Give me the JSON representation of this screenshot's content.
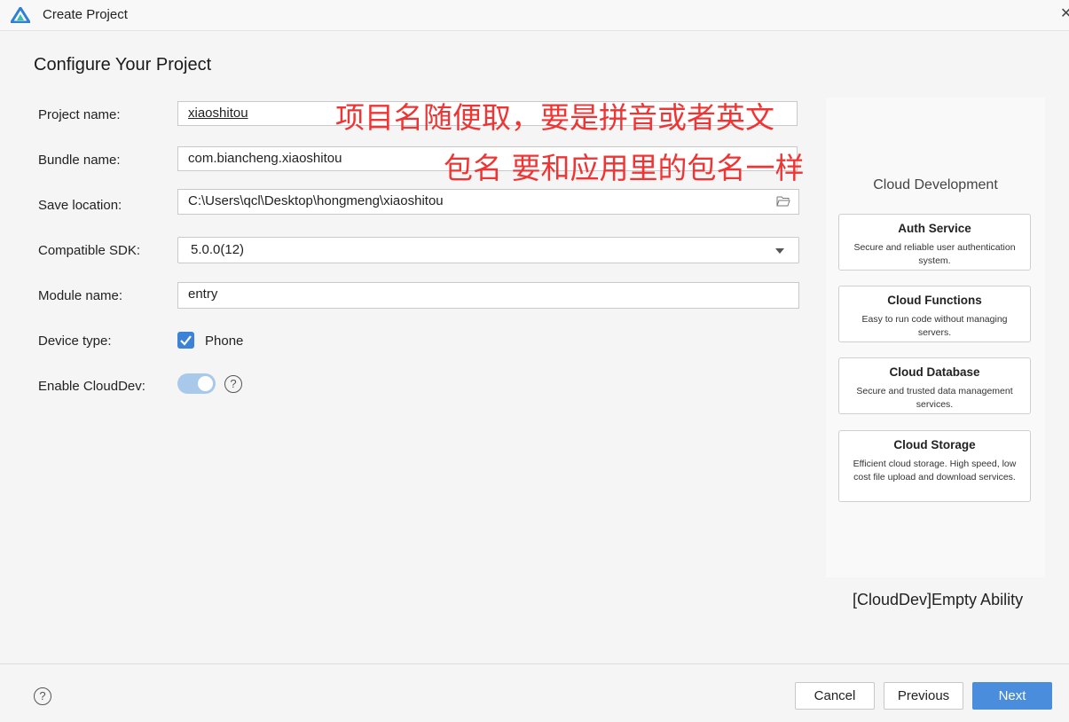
{
  "window": {
    "title": "Create Project"
  },
  "page": {
    "heading": "Configure Your Project"
  },
  "form": {
    "project_name": {
      "label": "Project name:",
      "value": "xiaoshitou"
    },
    "bundle_name": {
      "label": "Bundle name:",
      "value": "com.biancheng.xiaoshitou"
    },
    "save_location": {
      "label": "Save location:",
      "value": "C:\\Users\\qcl\\Desktop\\hongmeng\\xiaoshitou"
    },
    "compatible_sdk": {
      "label": "Compatible SDK:",
      "value": "5.0.0(12)"
    },
    "module_name": {
      "label": "Module name:",
      "value": "entry"
    },
    "device_type": {
      "label": "Device type:",
      "option": "Phone",
      "checked": true
    },
    "enable_clouddev": {
      "label": "Enable CloudDev:",
      "enabled": true
    }
  },
  "annotations": {
    "line1": "项目名随便取，要是拼音或者英文",
    "line2": "包名 要和应用里的包名一样"
  },
  "cloud_panel": {
    "heading": "Cloud Development",
    "services": [
      {
        "title": "Auth Service",
        "desc": "Secure and reliable user authentication system."
      },
      {
        "title": "Cloud Functions",
        "desc": "Easy to run code without managing servers."
      },
      {
        "title": "Cloud Database",
        "desc": "Secure and trusted data management services."
      },
      {
        "title": "Cloud Storage",
        "desc": "Efficient cloud storage. High speed, low cost file upload and download services."
      }
    ],
    "template_name": "[CloudDev]Empty Ability"
  },
  "footer": {
    "cancel_label": "Cancel",
    "previous_label": "Previous",
    "next_label": "Next"
  },
  "colors": {
    "accent": "#4a8ddc",
    "annotation": "#f03434",
    "toggle_on": "#a9c9ea"
  }
}
